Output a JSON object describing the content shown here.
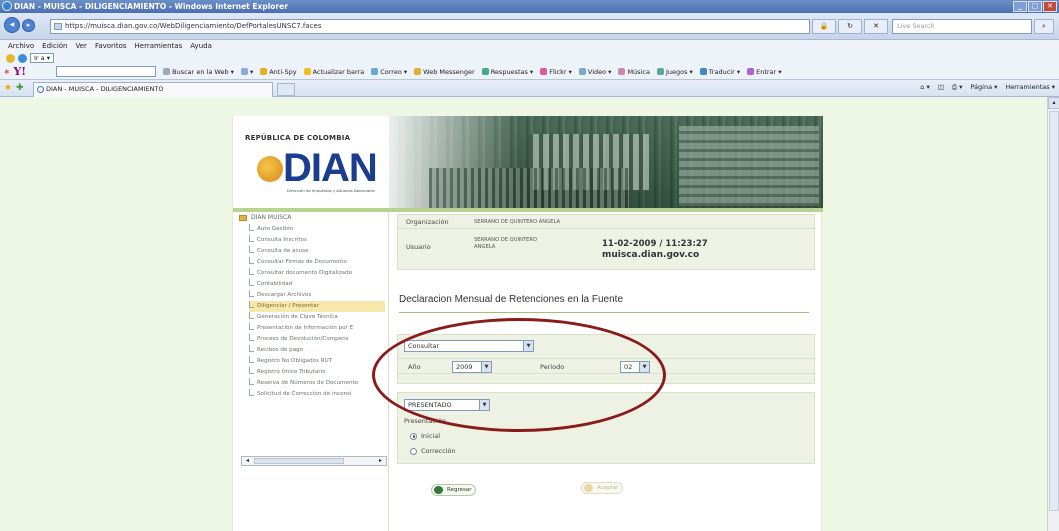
{
  "window": {
    "title": "DIAN - MUISCA - DILIGENCIAMIENTO - Windows Internet Explorer",
    "btn_min": "_",
    "btn_max": "□",
    "btn_close": "✕"
  },
  "address_bar": {
    "url": "https://muisca.dian.gov.co/WebDiligenciamiento/DefPortalesUNSC7.faces",
    "search_placeholder": "Live Search"
  },
  "menu": [
    "Archivo",
    "Edición",
    "Ver",
    "Favoritos",
    "Herramientas",
    "Ayuda"
  ],
  "links_row": {
    "go_label": "Ir a ▾"
  },
  "toolbar": {
    "items": [
      "Buscar en la Web ▾",
      "▾",
      "Anti-Spy",
      "Actualizar barra",
      "Correo ▾",
      "Web Messenger",
      "Respuestas ▾",
      "Flickr ▾",
      "Video ▾",
      "Música",
      "Juegos ▾",
      "Traducir ▾",
      "Entrar ▾"
    ]
  },
  "tab": {
    "title": "DIAN - MUISCA - DILIGENCIAMIENTO",
    "tools": [
      "Página ▾",
      "Herramientas ▾"
    ]
  },
  "header": {
    "republica": "REPÚBLICA DE COLOMBIA",
    "logo": "DIAN",
    "logo_sub": "Dirección de Impuestos y Aduanas Nacionales"
  },
  "tree": {
    "root": "DIAN MUISCA",
    "items": [
      "Auto Gestión",
      "Consulta Inscritos",
      "Consulta de acuse",
      "Consultar Firmas de Documento",
      "Consultar documento Digitalizado",
      "Contabilidad",
      "Descargar Archivos",
      "Diligenciar / Presentar",
      "Generación de Clave Técnica",
      "Presentación de Información por E",
      "Proceso de Devolución/Compens",
      "Recibos de pago",
      "Registro No Obligados RUT",
      "Registro Único Tributario",
      "Reserva de Números de Documento",
      "Solicitud de Corrección de inconsi"
    ],
    "active_index": 7,
    "scroll_left": "◂",
    "scroll_right": "▸"
  },
  "info": {
    "org_label": "Organización",
    "org_value": "SERRANO DE QUINTERO ANGELA",
    "user_label": "Usuario",
    "user_value_line1": "SERRANO DE QUINTERO",
    "user_value_line2": "ANGELA",
    "datetime": "11-02-2009 / 11:23:27",
    "site": "muisca.dian.gov.co"
  },
  "page_title": "Declaracion Mensual de Retenciones en la Fuente",
  "form": {
    "action_value": "Consultar",
    "year_label": "Año",
    "year_value": "2009",
    "period_label": "Periodo",
    "period_value": "02",
    "status_value": "PRESENTADO",
    "presentation_label": "Presentación",
    "radio_initial": "Inicial",
    "radio_correction": "Corrección",
    "selected_radio": "Inicial"
  },
  "buttons": {
    "back": "Regresar",
    "accept": "Aceptar"
  },
  "colors": {
    "annotation": "#8b1a1a",
    "logo_blue": "#1a3d8f",
    "background_green": "#eef7e4"
  }
}
